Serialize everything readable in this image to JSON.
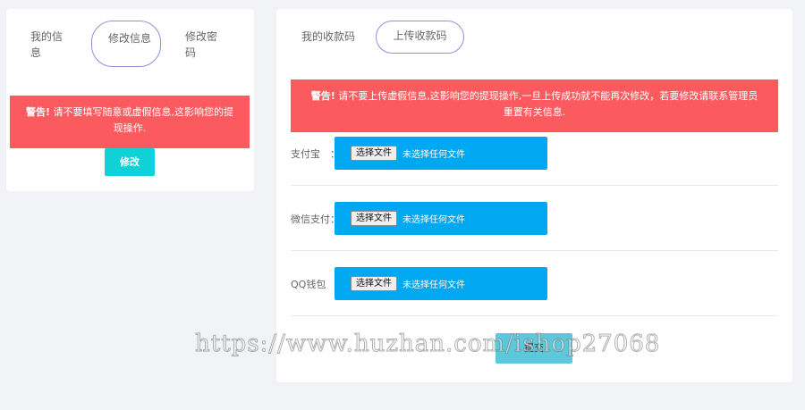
{
  "left": {
    "tabs": [
      {
        "label": "我的信息"
      },
      {
        "label": "修改信息"
      },
      {
        "label": "修改密码"
      }
    ],
    "alert": {
      "strong": "警告!",
      "text": " 请不要填写随意或虚假信息,这影响您的提现操作."
    },
    "modify_button": "修改"
  },
  "right": {
    "tabs": [
      {
        "label": "我的收款码"
      },
      {
        "label": "上传收款码"
      }
    ],
    "alert": {
      "strong": "警告!",
      "text": " 请不要上传虚假信息,这影响您的提现操作,一旦上传成功就不能再次修改，若要修改请联系管理员重置有关信息."
    },
    "uploads": [
      {
        "label": "支付宝　：",
        "button": "选择文件",
        "status": "未选择任何文件"
      },
      {
        "label": "微信支付：",
        "button": "选择文件",
        "status": "未选择任何文件"
      },
      {
        "label": "QQ钱包　：",
        "button": "选择文件",
        "status": "未选择任何文件"
      }
    ],
    "confirm_button": "提交"
  },
  "watermark": "https://www.huzhan.com/ishop27068",
  "colors": {
    "alert_bg": "#fb5b5e",
    "modify_button": "#0fd1d6",
    "upload_box": "#00a8f2",
    "confirm_button": "#5bc8dc",
    "active_tab_border": "#8a94d6"
  }
}
